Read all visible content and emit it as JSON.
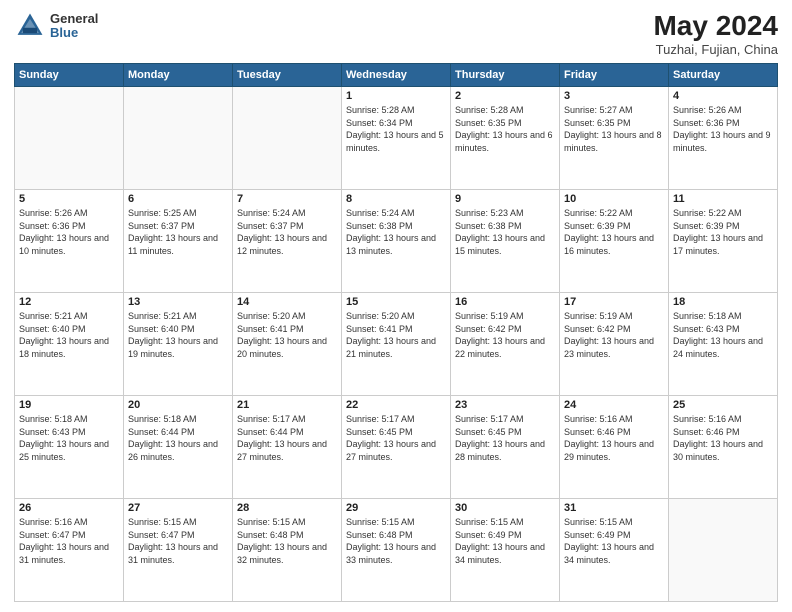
{
  "header": {
    "logo_general": "General",
    "logo_blue": "Blue",
    "title": "May 2024",
    "subtitle": "Tuzhai, Fujian, China"
  },
  "calendar": {
    "days_of_week": [
      "Sunday",
      "Monday",
      "Tuesday",
      "Wednesday",
      "Thursday",
      "Friday",
      "Saturday"
    ],
    "weeks": [
      [
        {
          "day": "",
          "info": ""
        },
        {
          "day": "",
          "info": ""
        },
        {
          "day": "",
          "info": ""
        },
        {
          "day": "1",
          "info": "Sunrise: 5:28 AM\nSunset: 6:34 PM\nDaylight: 13 hours\nand 5 minutes."
        },
        {
          "day": "2",
          "info": "Sunrise: 5:28 AM\nSunset: 6:35 PM\nDaylight: 13 hours\nand 6 minutes."
        },
        {
          "day": "3",
          "info": "Sunrise: 5:27 AM\nSunset: 6:35 PM\nDaylight: 13 hours\nand 8 minutes."
        },
        {
          "day": "4",
          "info": "Sunrise: 5:26 AM\nSunset: 6:36 PM\nDaylight: 13 hours\nand 9 minutes."
        }
      ],
      [
        {
          "day": "5",
          "info": "Sunrise: 5:26 AM\nSunset: 6:36 PM\nDaylight: 13 hours\nand 10 minutes."
        },
        {
          "day": "6",
          "info": "Sunrise: 5:25 AM\nSunset: 6:37 PM\nDaylight: 13 hours\nand 11 minutes."
        },
        {
          "day": "7",
          "info": "Sunrise: 5:24 AM\nSunset: 6:37 PM\nDaylight: 13 hours\nand 12 minutes."
        },
        {
          "day": "8",
          "info": "Sunrise: 5:24 AM\nSunset: 6:38 PM\nDaylight: 13 hours\nand 13 minutes."
        },
        {
          "day": "9",
          "info": "Sunrise: 5:23 AM\nSunset: 6:38 PM\nDaylight: 13 hours\nand 15 minutes."
        },
        {
          "day": "10",
          "info": "Sunrise: 5:22 AM\nSunset: 6:39 PM\nDaylight: 13 hours\nand 16 minutes."
        },
        {
          "day": "11",
          "info": "Sunrise: 5:22 AM\nSunset: 6:39 PM\nDaylight: 13 hours\nand 17 minutes."
        }
      ],
      [
        {
          "day": "12",
          "info": "Sunrise: 5:21 AM\nSunset: 6:40 PM\nDaylight: 13 hours\nand 18 minutes."
        },
        {
          "day": "13",
          "info": "Sunrise: 5:21 AM\nSunset: 6:40 PM\nDaylight: 13 hours\nand 19 minutes."
        },
        {
          "day": "14",
          "info": "Sunrise: 5:20 AM\nSunset: 6:41 PM\nDaylight: 13 hours\nand 20 minutes."
        },
        {
          "day": "15",
          "info": "Sunrise: 5:20 AM\nSunset: 6:41 PM\nDaylight: 13 hours\nand 21 minutes."
        },
        {
          "day": "16",
          "info": "Sunrise: 5:19 AM\nSunset: 6:42 PM\nDaylight: 13 hours\nand 22 minutes."
        },
        {
          "day": "17",
          "info": "Sunrise: 5:19 AM\nSunset: 6:42 PM\nDaylight: 13 hours\nand 23 minutes."
        },
        {
          "day": "18",
          "info": "Sunrise: 5:18 AM\nSunset: 6:43 PM\nDaylight: 13 hours\nand 24 minutes."
        }
      ],
      [
        {
          "day": "19",
          "info": "Sunrise: 5:18 AM\nSunset: 6:43 PM\nDaylight: 13 hours\nand 25 minutes."
        },
        {
          "day": "20",
          "info": "Sunrise: 5:18 AM\nSunset: 6:44 PM\nDaylight: 13 hours\nand 26 minutes."
        },
        {
          "day": "21",
          "info": "Sunrise: 5:17 AM\nSunset: 6:44 PM\nDaylight: 13 hours\nand 27 minutes."
        },
        {
          "day": "22",
          "info": "Sunrise: 5:17 AM\nSunset: 6:45 PM\nDaylight: 13 hours\nand 27 minutes."
        },
        {
          "day": "23",
          "info": "Sunrise: 5:17 AM\nSunset: 6:45 PM\nDaylight: 13 hours\nand 28 minutes."
        },
        {
          "day": "24",
          "info": "Sunrise: 5:16 AM\nSunset: 6:46 PM\nDaylight: 13 hours\nand 29 minutes."
        },
        {
          "day": "25",
          "info": "Sunrise: 5:16 AM\nSunset: 6:46 PM\nDaylight: 13 hours\nand 30 minutes."
        }
      ],
      [
        {
          "day": "26",
          "info": "Sunrise: 5:16 AM\nSunset: 6:47 PM\nDaylight: 13 hours\nand 31 minutes."
        },
        {
          "day": "27",
          "info": "Sunrise: 5:15 AM\nSunset: 6:47 PM\nDaylight: 13 hours\nand 31 minutes."
        },
        {
          "day": "28",
          "info": "Sunrise: 5:15 AM\nSunset: 6:48 PM\nDaylight: 13 hours\nand 32 minutes."
        },
        {
          "day": "29",
          "info": "Sunrise: 5:15 AM\nSunset: 6:48 PM\nDaylight: 13 hours\nand 33 minutes."
        },
        {
          "day": "30",
          "info": "Sunrise: 5:15 AM\nSunset: 6:49 PM\nDaylight: 13 hours\nand 34 minutes."
        },
        {
          "day": "31",
          "info": "Sunrise: 5:15 AM\nSunset: 6:49 PM\nDaylight: 13 hours\nand 34 minutes."
        },
        {
          "day": "",
          "info": ""
        }
      ]
    ]
  }
}
